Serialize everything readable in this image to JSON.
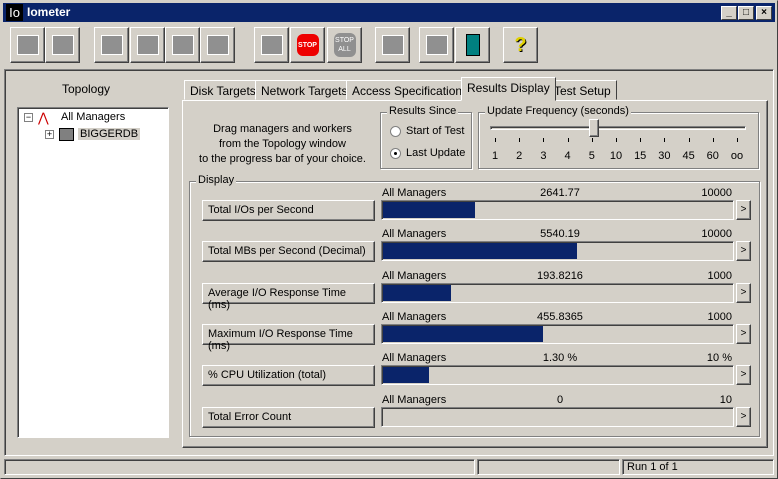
{
  "window": {
    "title": "Iometer",
    "logo": "Io"
  },
  "toolbar": [
    {
      "name": "open-icon"
    },
    {
      "name": "save-icon"
    },
    {
      "name": "start-manager-icon"
    },
    {
      "name": "start-disk-worker-icon"
    },
    {
      "name": "start-network-worker-icon"
    },
    {
      "name": "duplicate-worker-icon"
    },
    {
      "name": "start-tests-icon"
    },
    {
      "name": "stop-icon",
      "label": "STOP"
    },
    {
      "name": "stop-all-icon",
      "label": "STOP ALL"
    },
    {
      "name": "reset-workers-icon"
    },
    {
      "name": "disconnect-icon"
    },
    {
      "name": "exit-icon"
    },
    {
      "name": "help-icon",
      "label": "?"
    }
  ],
  "topology": {
    "title": "Topology",
    "root": "All Managers",
    "children": [
      "BIGGERDB"
    ]
  },
  "tabs": [
    "Disk Targets",
    "Network Targets",
    "Access Specifications",
    "Results Display",
    "Test Setup"
  ],
  "active_tab": "Results Display",
  "instructions": [
    "Drag managers and workers",
    "from the Topology window",
    "to the progress bar of your choice."
  ],
  "results_since": {
    "title": "Results Since",
    "options": [
      "Start of Test",
      "Last Update"
    ],
    "selected": "Last Update"
  },
  "update_frequency": {
    "title": "Update Frequency (seconds)",
    "ticks": [
      "1",
      "2",
      "3",
      "4",
      "5",
      "10",
      "15",
      "30",
      "45",
      "60",
      "oo"
    ],
    "selected": "5"
  },
  "display": {
    "title": "Display",
    "rows": [
      {
        "label": "Total I/Os per Second",
        "source": "All Managers",
        "value": "2641.77",
        "max": "10000",
        "fraction": 0.264
      },
      {
        "label": "Total MBs per Second (Decimal)",
        "source": "All Managers",
        "value": "5540.19",
        "max": "10000",
        "fraction": 0.554
      },
      {
        "label": "Average I/O Response Time (ms)",
        "source": "All Managers",
        "value": "193.8216",
        "max": "1000",
        "fraction": 0.194
      },
      {
        "label": "Maximum I/O Response Time (ms)",
        "source": "All Managers",
        "value": "455.8365",
        "max": "1000",
        "fraction": 0.456
      },
      {
        "label": "% CPU Utilization (total)",
        "source": "All Managers",
        "value": "1.30 %",
        "max": "10 %",
        "fraction": 0.13
      },
      {
        "label": "Total Error Count",
        "source": "All Managers",
        "value": "0",
        "max": "10",
        "fraction": 0
      }
    ],
    "arrow": ">"
  },
  "status": {
    "run": "Run 1 of 1"
  }
}
